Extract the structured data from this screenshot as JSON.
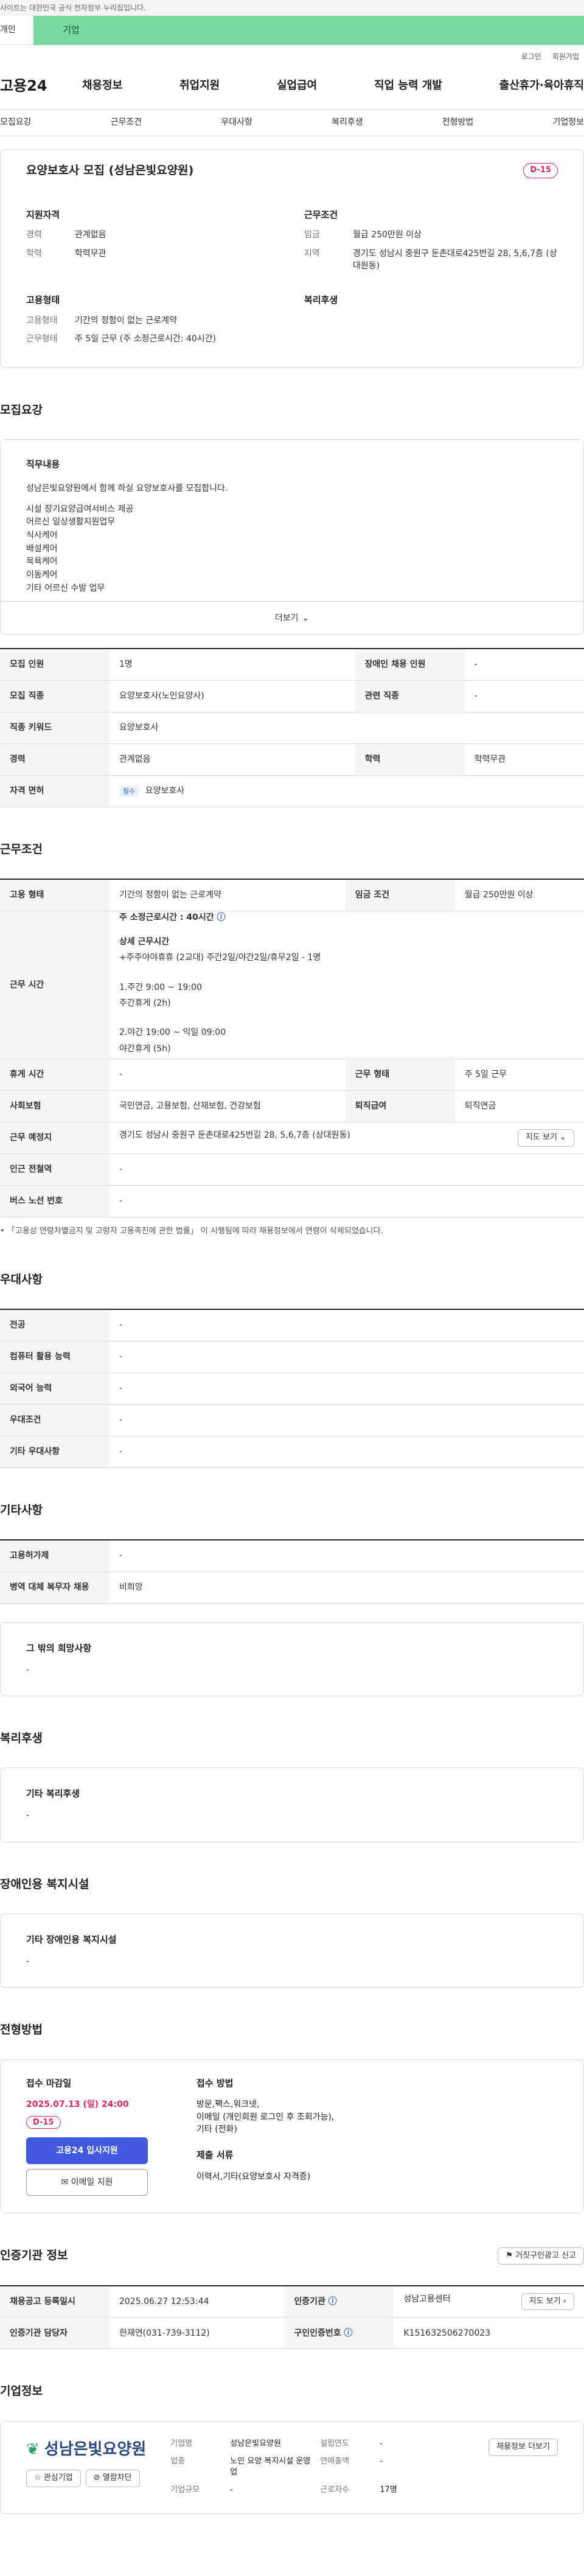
{
  "top_notice": "사이트는 대한민국 공식 전자정부 누리집입니다.",
  "audience_tabs": [
    "개인",
    "기업"
  ],
  "utility": [
    "로그인",
    "회원가입"
  ],
  "logo": "고용24",
  "gnb": [
    "채용정보",
    "취업지원",
    "실업급여",
    "직업 능력 개발",
    "출산휴가·육아휴직"
  ],
  "subnav": [
    "모집요강",
    "근무조건",
    "우대사항",
    "복리후생",
    "전형방법",
    "기업정보"
  ],
  "job": {
    "title": "요양보호사 모집 (성남은빛요양원)",
    "dday": "D-15",
    "summary": {
      "qual_h": "지원자격",
      "qual": [
        {
          "k": "경력",
          "v": "관계없음"
        },
        {
          "k": "학력",
          "v": "학력무관"
        }
      ],
      "cond_h": "근무조건",
      "cond": [
        {
          "k": "임금",
          "v": "월급 250만원 이상"
        },
        {
          "k": "지역",
          "v": "경기도 성남시 중원구 둔촌대로425번길 28, 5,6,7층 (상대원동)"
        }
      ],
      "emp_h": "고용형태",
      "emp": [
        {
          "k": "고용형태",
          "v": "기간의 정함이 없는 근로계약"
        },
        {
          "k": "근무형태",
          "v": "주 5일 근무 (주 소정근로시간: 40시간)"
        }
      ],
      "welfare_h": "복리후생"
    }
  },
  "recruit": {
    "section": "모집요강",
    "content_h": "직무내용",
    "lines": [
      "성남은빛요양원에서 함께 하실 요양보호사를 모집합니다.",
      "",
      "시설 장기요양급여서비스 제공",
      "어르신 일상생활지원업무",
      "식사케어",
      "배설케어",
      "목욕케어",
      "이동케어",
      "기타 어르신 수발 업무"
    ],
    "more": "더보기",
    "rows": [
      [
        "모집 인원",
        "1명",
        "장애인 채용 인원",
        "-"
      ],
      [
        "모집 직종",
        "요양보호사(노인요양사)",
        "관련 직종",
        "-"
      ]
    ],
    "keyword_k": "직종 키워드",
    "keyword_v": "요양보호사",
    "career_k": "경력",
    "career_v": "관계없음",
    "edu_k": "학력",
    "edu_v": "학력무관",
    "license_k": "자격 면허",
    "license_badge": "필수",
    "license_v": "요양보호사"
  },
  "work": {
    "section": "근무조건",
    "emp_k": "고용 형태",
    "emp_v": "기간의 정함이 없는 근로계약",
    "wage_k": "임금 조건",
    "wage_v": "월급 250만원 이상",
    "time_k": "근무 시간",
    "time_lines": [
      "주 소정근로시간 : 40시간",
      "",
      "상세 근무시간",
      "+주주야야휴휴 (2교대) 주간2일/야간2일/휴무2일 - 1명",
      "",
      "1.주간 9:00 ~ 19:00",
      "주간휴게 (2h)",
      "",
      "2.야간 19:00 ~ 익일 09:00",
      "야간휴게 (5h)"
    ],
    "rest_k": "휴게 시간",
    "rest_v": "-",
    "type_k": "근무 형태",
    "type_v": "주 5일 근무",
    "ins_k": "사회보험",
    "ins_v": "국민연금, 고용보험, 산재보험, 건강보험",
    "ret_k": "퇴직급여",
    "ret_v": "퇴직연금",
    "place_k": "근무 예정지",
    "place_v": "경기도 성남시 중원구 둔촌대로425번길 28, 5,6,7층 (상대원동)",
    "map_btn": "지도 보기",
    "station_k": "인근 전철역",
    "station_v": "-",
    "bus_k": "버스 노선 번호",
    "bus_v": "-",
    "note": "「고용상 연령차별금지 및 고령자 고용촉진에 관한 법률」 이 시행됨에 따라 채용정보에서 연령이 삭제되었습니다."
  },
  "pref": {
    "section": "우대사항",
    "rows": [
      [
        "전공",
        "-"
      ],
      [
        "컴퓨터 활용 능력",
        "-"
      ],
      [
        "외국어 능력",
        "-"
      ],
      [
        "우대조건",
        "-"
      ],
      [
        "기타 우대사항",
        "-"
      ]
    ]
  },
  "other": {
    "section": "기타사항",
    "rows": [
      [
        "고용허가제",
        "-"
      ],
      [
        "병역 대체 복무자 채용",
        "비희망"
      ]
    ],
    "box_h": "그 밖의 희망사항",
    "box_v": "-"
  },
  "welfare": {
    "section": "복리후생",
    "box_h": "기타 복리후생",
    "box_v": "-"
  },
  "disabled": {
    "section": "장애인용 복지시설",
    "box_h": "기타 장애인용 복지시설",
    "box_v": "-"
  },
  "selection": {
    "section": "전형방법",
    "deadline_h": "접수 마감일",
    "deadline": "2025.07.13 (일) 24:00",
    "dday": "D-15",
    "apply_btn": "고용24 입사지원",
    "email_btn": "이메일 지원",
    "method_h": "접수 방법",
    "method": [
      "방문,팩스,워크넷,",
      "이메일 (개인회원 로그인 후 조회가능),",
      "기타 (전화)"
    ],
    "docs_h": "제출 서류",
    "docs": "이력서,기타(요양보호사 자격증)"
  },
  "cert": {
    "section": "인증기관 정보",
    "report_btn": "거짓구인광고 신고",
    "reg_k": "채용공고 등록일시",
    "reg_v": "2025.06.27 12:53:44",
    "org_k": "인증기관",
    "org_v": "성남고용센터",
    "map_btn": "지도 보기",
    "mgr_k": "인증기관 담당자",
    "mgr_v": "한재연(031-739-3112)",
    "no_k": "구인인증번호",
    "no_v": "K151632506270023"
  },
  "company": {
    "section": "기업정보",
    "logo_text": "성남은빛요양원",
    "fav_btn": "관심기업",
    "block_btn": "열람차단",
    "fields": [
      [
        "기업명",
        "성남은빛요양원",
        "설립연도",
        "-"
      ],
      [
        "업종",
        "노인 요양 복지시설 운영업",
        "연매출액",
        "-"
      ],
      [
        "기업규모",
        "-",
        "근로자수",
        "17명"
      ]
    ],
    "more_btn": "채용정보 더보기"
  }
}
